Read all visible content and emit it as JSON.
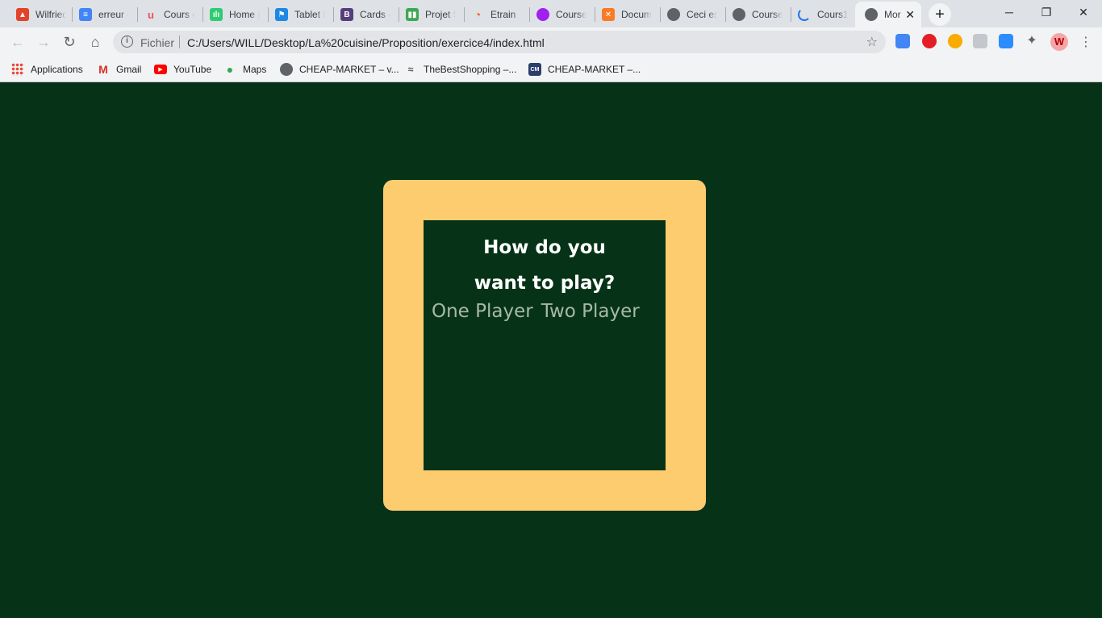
{
  "browser": {
    "tabs": [
      {
        "title": "Wilfried",
        "icon": "gitlab-icon",
        "color": "#e24329"
      },
      {
        "title": "erreur -",
        "icon": "docs-icon",
        "color": "#4285f4"
      },
      {
        "title": "Cours e",
        "icon": "udemy-icon",
        "color": "#ec5252"
      },
      {
        "title": "Home |",
        "icon": "app-icon",
        "color": "#2ecc71"
      },
      {
        "title": "Tablet la",
        "icon": "flag-icon",
        "color": "#1e88e5"
      },
      {
        "title": "Cards -",
        "icon": "bootstrap-icon",
        "color": "#563d7c"
      },
      {
        "title": "Projet S",
        "icon": "trello-icon",
        "color": "#3fa852"
      },
      {
        "title": "Etrain",
        "icon": "etrain-icon",
        "color": "#f15a24"
      },
      {
        "title": "Courses",
        "icon": "courses-icon",
        "color": "#a020f0"
      },
      {
        "title": "Docum",
        "icon": "xampp-icon",
        "color": "#fb7a24"
      },
      {
        "title": "Ceci est",
        "icon": "globe-icon",
        "color": "#5f6368"
      },
      {
        "title": "Courses",
        "icon": "globe-icon",
        "color": "#5f6368"
      },
      {
        "title": "Cours1",
        "icon": "loading-icon",
        "color": "#1a73e8"
      },
      {
        "title": "Mor",
        "icon": "globe-icon",
        "color": "#5f6368",
        "active": true
      }
    ],
    "address": {
      "scheme_label": "Fichier",
      "url": "C:/Users/WILL/Desktop/La%20cuisine/Proposition/exercice4/index.html"
    },
    "bookmarks": [
      {
        "label": "Applications",
        "icon": "apps-grid-icon"
      },
      {
        "label": "Gmail",
        "icon": "gmail-icon"
      },
      {
        "label": "YouTube",
        "icon": "youtube-icon"
      },
      {
        "label": "Maps",
        "icon": "maps-icon"
      },
      {
        "label": "CHEAP-MARKET – v...",
        "icon": "globe-icon"
      },
      {
        "label": "TheBestShopping –...",
        "icon": "shop-icon"
      },
      {
        "label": "CHEAP-MARKET –...",
        "icon": "market-icon"
      }
    ]
  },
  "game": {
    "question_line1": "How do you",
    "question_line2": "want to play?",
    "option_one": "One Player",
    "option_two": "Two Player",
    "colors": {
      "background": "#063318",
      "frame": "#fccc6e",
      "option_text": "#a8b8a8"
    }
  }
}
